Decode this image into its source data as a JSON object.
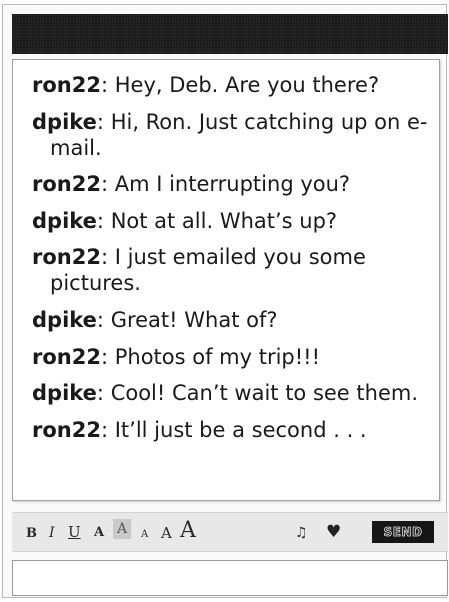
{
  "conversation": [
    {
      "sender": "ron22",
      "text": "Hey, Deb. Are you there?"
    },
    {
      "sender": "dpike",
      "text": "Hi, Ron. Just catching up on e-mail."
    },
    {
      "sender": "ron22",
      "text": "Am I interrupting you?"
    },
    {
      "sender": "dpike",
      "text": "Not at all. What’s up?"
    },
    {
      "sender": "ron22",
      "text": "I just emailed you some pictures."
    },
    {
      "sender": "dpike",
      "text": "Great! What of?"
    },
    {
      "sender": "ron22",
      "text": "Photos of my trip!!!"
    },
    {
      "sender": "dpike",
      "text": "Cool! Can’t wait to see them."
    },
    {
      "sender": "ron22",
      "text": "It’ll just be a second . . ."
    }
  ],
  "separator": ": ",
  "toolbar": {
    "bold": "B",
    "italic": "I",
    "underline": "U",
    "font_color": "A",
    "highlight": "A",
    "size_small": "A",
    "size_medium": "A",
    "size_large": "A",
    "music_icon": "music-note-icon",
    "heart_icon": "heart-icon",
    "send_label": "SEND"
  },
  "compose": {
    "value": "",
    "placeholder": ""
  },
  "colors": {
    "title_bar": "#1b1b1b",
    "chat_background": "#ffffff",
    "toolbar_background": "#e8e8e8",
    "send_button": "#161616"
  }
}
